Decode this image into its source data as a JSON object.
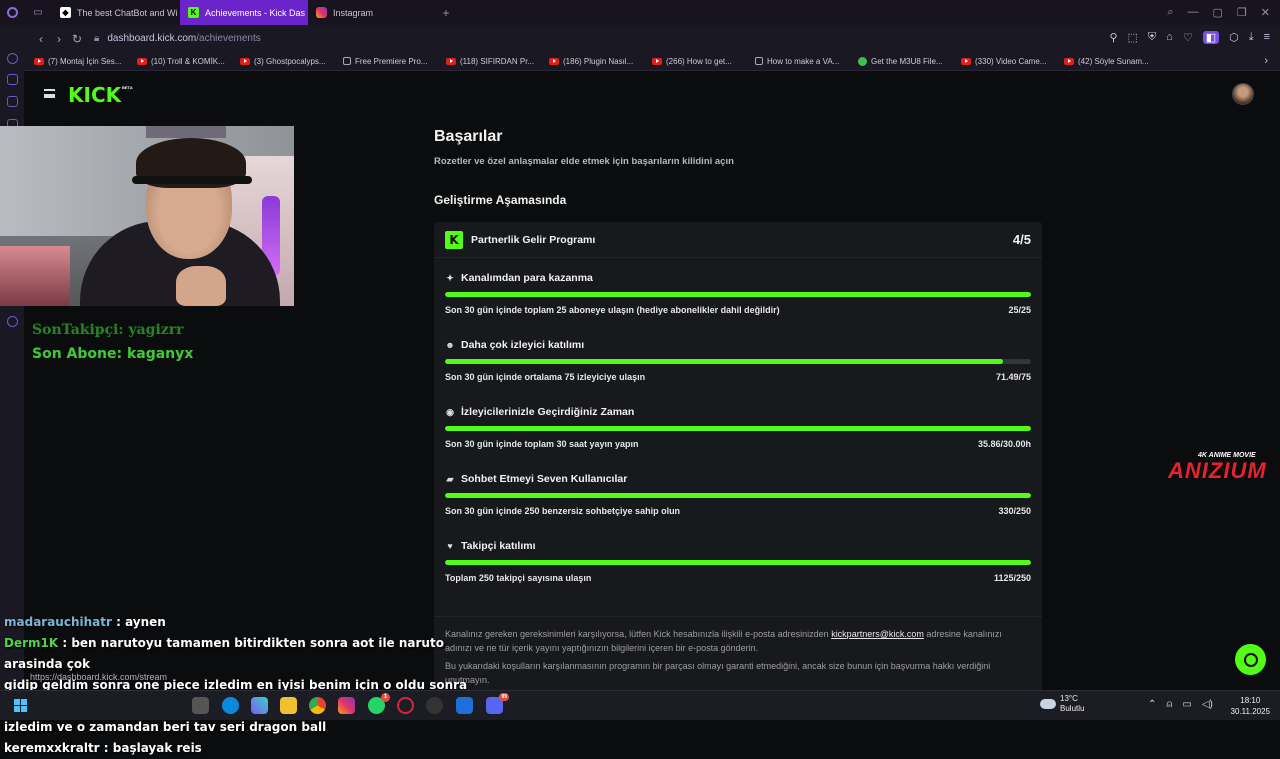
{
  "browser": {
    "tabs": [
      {
        "label": "The best ChatBot and Wi",
        "color": "#ffffff",
        "icon": "chatbot-icon"
      },
      {
        "label": "Achievements - Kick Das",
        "color": "#53fc18",
        "icon": "kick-icon",
        "active": true
      },
      {
        "label": "Instagram",
        "color": "#e1306c",
        "icon": "instagram-icon"
      }
    ],
    "url_host": "dashboard.kick.com",
    "url_path": "/achievements",
    "bookmarks": [
      "(7) Montaj İçin Ses...",
      "(10) Troll & KOMİK...",
      "(3) Ghostpocalyps...",
      "Free Premiere Pro...",
      "(118) SIFIRDAN Pr...",
      "(186) Plugin Nasıl...",
      "(266) How to get...",
      "How to make a VA...",
      "Get the M3U8 File...",
      "(330) Video Came...",
      "(42) Söyle Sunam..."
    ]
  },
  "kick": {
    "logo": "KICK",
    "beta": "BETA"
  },
  "overlay": {
    "last_follower": "SonTakipçi: yagizrr",
    "last_sub": "Son Abone: kaganyx",
    "watermark_top": "4K ANIME MOVIE",
    "watermark_main": "ANIZIUM"
  },
  "chat": [
    {
      "user": "madarauchihatr",
      "msg": " : aynen"
    },
    {
      "user": "Derm1K",
      "msg": " : ben narutoyu tamamen bitirdikten sonra aot ile naruto arasinda çok"
    },
    {
      "user": "",
      "msg": "gidip geldim sonra one piece izledim en iyisi benim için o oldu sonra dragon ball"
    },
    {
      "user": "",
      "msg": "izledim ve o zamandan beri tav seri dragon ball"
    },
    {
      "user": "keremxxkraltr",
      "msg": " : başlayak reis"
    }
  ],
  "status_url": "https://dashboard.kick.com/stream",
  "page": {
    "title": "Başarılar",
    "subtitle": "Rozetler ve özel anlaşmalar elde etmek için başarıların kilidini açın",
    "section": "Geliştirme Aşamasında",
    "program_title": "Partnerlik Gelir Programı",
    "program_progress": "4/5",
    "goals": [
      {
        "icon": "sparkle-icon",
        "glyph": "✦",
        "title": "Kanalımdan para kazanma",
        "desc": "Son 30 gün içinde toplam 25 aboneye ulaşın (hediye abonelikler dahil değildir)",
        "value": "25/25",
        "fraction": 1.0
      },
      {
        "icon": "users-icon",
        "glyph": "☻",
        "title": "Daha çok izleyici katılımı",
        "desc": "Son 30 gün içinde ortalama 75 izleyiciye ulaşın",
        "value": "71.49/75",
        "fraction": 0.953
      },
      {
        "icon": "broadcast-icon",
        "glyph": "◉",
        "title": "İzleyicilerinizle Geçirdiğiniz Zaman",
        "desc": "Son 30 gün içinde toplam 30 saat yayın yapın",
        "value": "35.86/30.00h",
        "fraction": 1.0
      },
      {
        "icon": "chat-bubble-icon",
        "glyph": "▰",
        "title": "Sohbet Etmeyi Seven Kullanıcılar",
        "desc": "Son 30 gün içinde 250 benzersiz sohbetçiye sahip olun",
        "value": "330/250",
        "fraction": 1.0
      },
      {
        "icon": "heart-icon",
        "glyph": "♥",
        "title": "Takipçi katılımı",
        "desc": "Toplam 250 takipçi sayısına ulaşın",
        "value": "1125/250",
        "fraction": 1.0
      }
    ],
    "footer_1a": "Kanalınız gereken gereksinimleri karşılıyorsa, lütfen Kick hesabınızla ilişkili e-posta adresinizden ",
    "footer_email": "kickpartners@kick.com",
    "footer_1b": " adresine kanalınızı adınızı ve ne tür içerik yayını yaptığınızın bilgilerini içeren bir e-posta gönderin.",
    "footer_2": "Bu yukarıdaki koşulların karşılanmasının programın bir parçası olmayı garanti etmediğini, ancak size bunun için başvurma hakkı verdiğini unutmayın."
  },
  "taskbar": {
    "temp": "13°C",
    "weather": "Bulutlu",
    "time": "18:10",
    "date": "30.11.2025",
    "badge_whatsapp": "1",
    "badge_discord": "99"
  },
  "colors": {
    "accent": "#53fc18",
    "opera_active_tab": "#6a24c9"
  }
}
